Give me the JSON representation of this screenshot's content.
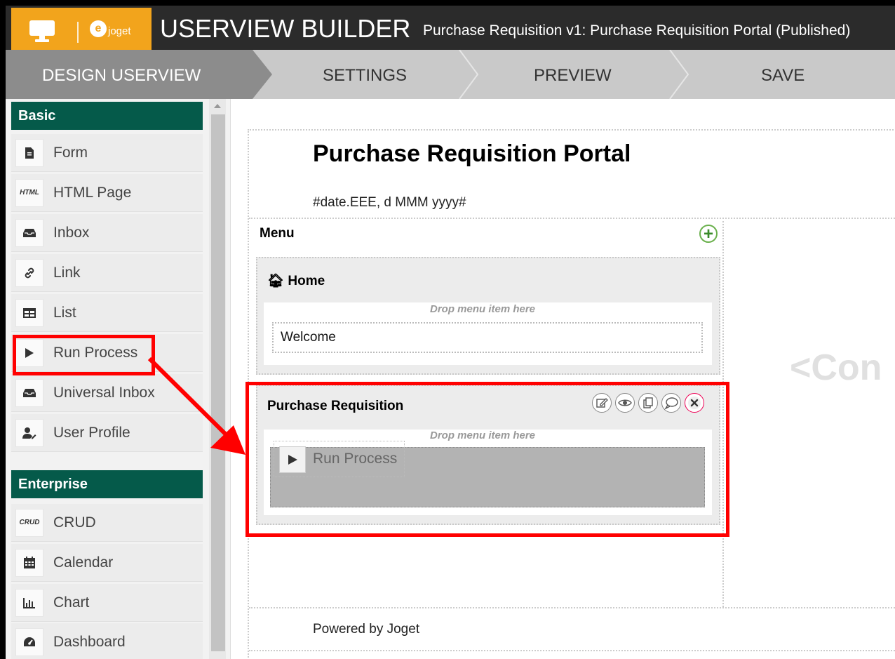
{
  "header": {
    "logo_text": "joget",
    "title": "USERVIEW BUILDER",
    "subtitle": "Purchase Requisition v1: Purchase Requisition Portal (Published)"
  },
  "nav": {
    "tabs": [
      {
        "label": "DESIGN USERVIEW",
        "active": true
      },
      {
        "label": "SETTINGS",
        "active": false
      },
      {
        "label": "PREVIEW",
        "active": false
      },
      {
        "label": "SAVE",
        "active": false
      }
    ]
  },
  "sidebar": {
    "categories": [
      {
        "label": "Basic",
        "items": [
          {
            "label": "Form",
            "icon": "form-icon"
          },
          {
            "label": "HTML Page",
            "icon": "html-icon",
            "icon_text": "HTML"
          },
          {
            "label": "Inbox",
            "icon": "inbox-icon"
          },
          {
            "label": "Link",
            "icon": "link-icon"
          },
          {
            "label": "List",
            "icon": "list-icon"
          },
          {
            "label": "Run Process",
            "icon": "play-icon"
          },
          {
            "label": "Universal Inbox",
            "icon": "inbox-icon"
          },
          {
            "label": "User Profile",
            "icon": "user-edit-icon"
          }
        ]
      },
      {
        "label": "Enterprise",
        "items": [
          {
            "label": "CRUD",
            "icon": "crud-icon",
            "icon_text": "CRUD"
          },
          {
            "label": "Calendar",
            "icon": "calendar-icon"
          },
          {
            "label": "Chart",
            "icon": "chart-icon"
          },
          {
            "label": "Dashboard",
            "icon": "dashboard-icon"
          }
        ]
      }
    ]
  },
  "canvas": {
    "title": "Purchase Requisition Portal",
    "date_text": "#date.EEE, d MMM yyyy#",
    "menu_label": "Menu",
    "categories": [
      {
        "label": "Home",
        "icon": "home-icon",
        "drop_hint": "Drop menu item here",
        "items": [
          "Welcome"
        ]
      },
      {
        "label": "Purchase Requisition",
        "drop_hint": "Drop menu item here",
        "dragging_item": "Run Process",
        "tools": [
          "edit-icon",
          "eye-icon",
          "copy-icon",
          "comment-icon",
          "delete-icon"
        ]
      }
    ],
    "content_placeholder": "<Con",
    "footer": "Powered by Joget"
  },
  "colors": {
    "logo_bg": "#f2a41c",
    "topbar_bg": "#2b2b2b",
    "nav_active_bg": "#8c8c8c",
    "nav_bg": "#c9c9c9",
    "category_header_bg": "#055a4a",
    "highlight": "#ff0000"
  }
}
